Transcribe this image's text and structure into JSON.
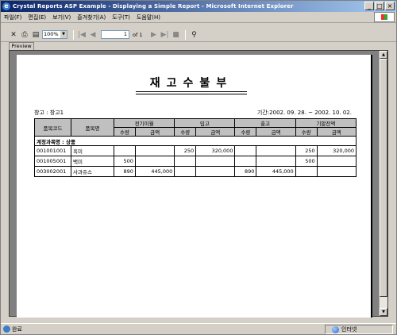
{
  "window": {
    "title": "Crystal Reports ASP Example - Displaying a Simple Report - Microsoft Internet Explorer"
  },
  "menu": [
    "파일(F)",
    "편집(E)",
    "보기(V)",
    "즐겨찾기(A)",
    "도구(T)",
    "도움말(H)"
  ],
  "toolbar": {
    "zoom": "100%",
    "page_current": "1",
    "page_of": "of 1"
  },
  "tab": {
    "label": "Preview"
  },
  "report": {
    "title": "재고수불부",
    "warehouse": "창고 : 창고1",
    "period": "기간:2002. 09. 28. ~ 2002. 10. 02.",
    "headers": {
      "code": "품목코드",
      "name": "품목명",
      "groups": [
        "전기이월",
        "입고",
        "출고",
        "기말잔액"
      ],
      "qty": "수량",
      "amount": "금액"
    },
    "group_label": "계정과목명 : 상품",
    "rows": [
      {
        "code": "001001001",
        "name": "흑미",
        "v": [
          "",
          "",
          "250",
          "320,000",
          "",
          "",
          "250",
          "320,000"
        ]
      },
      {
        "code": "001005001",
        "name": "백미",
        "v": [
          "500",
          "",
          "",
          "",
          "",
          "",
          "500",
          ""
        ]
      },
      {
        "code": "003002001",
        "name": "사과쥬스",
        "v": [
          "890",
          "445,000",
          "",
          "",
          "890",
          "445,000",
          "",
          ""
        ]
      }
    ]
  },
  "status": {
    "text": "완료",
    "zone": "인터넷"
  }
}
